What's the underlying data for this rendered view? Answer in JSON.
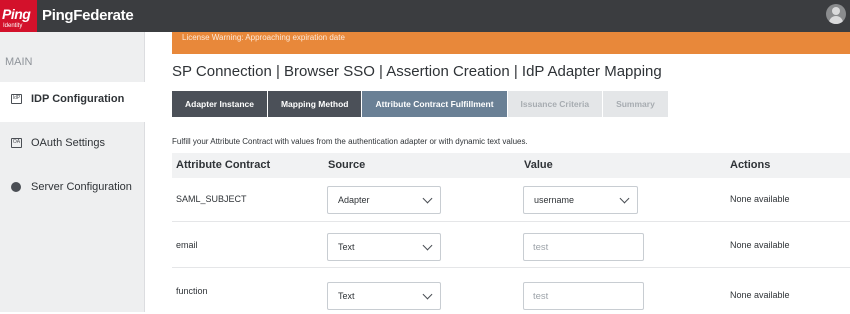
{
  "app": {
    "logo_text": "Ping",
    "logo_sub": "Identity",
    "brand": "PingFederate"
  },
  "sidebar": {
    "section": "MAIN",
    "items": [
      {
        "label": "IDP Configuration",
        "icon": "idp-icon",
        "icon_text": "IdP",
        "active": true
      },
      {
        "label": "OAuth Settings",
        "icon": "oauth-icon",
        "icon_text": "OA",
        "active": false
      },
      {
        "label": "Server Configuration",
        "icon": "server-icon",
        "icon_text": "",
        "active": false
      }
    ]
  },
  "warning": "License Warning: Approaching expiration date",
  "page_title": "SP Connection | Browser SSO | Assertion Creation | IdP Adapter Mapping",
  "tabs": [
    {
      "label": "Adapter Instance",
      "state": "done"
    },
    {
      "label": "Mapping Method",
      "state": "done"
    },
    {
      "label": "Attribute Contract Fulfillment",
      "state": "current"
    },
    {
      "label": "Issuance Criteria",
      "state": "pending"
    },
    {
      "label": "Summary",
      "state": "pending"
    }
  ],
  "instructions": "Fulfill your Attribute Contract with values from the authentication adapter or with dynamic text values.",
  "table": {
    "columns": [
      "Attribute Contract",
      "Source",
      "Value",
      "Actions"
    ],
    "rows": [
      {
        "attribute": "SAML_SUBJECT",
        "source": "Adapter",
        "value": "username",
        "value_type": "select",
        "actions": "None available"
      },
      {
        "attribute": "email",
        "source": "Text",
        "value": "test",
        "value_type": "text",
        "actions": "None available"
      },
      {
        "attribute": "function",
        "source": "Text",
        "value": "test",
        "value_type": "text",
        "actions": "None available"
      }
    ]
  },
  "colors": {
    "topbar": "#3b3d40",
    "logo": "#d3112b",
    "warning": "#e8883a",
    "tab_done": "#4b5058",
    "tab_current": "#6a8095",
    "tab_pending": "#e4e6e8"
  }
}
